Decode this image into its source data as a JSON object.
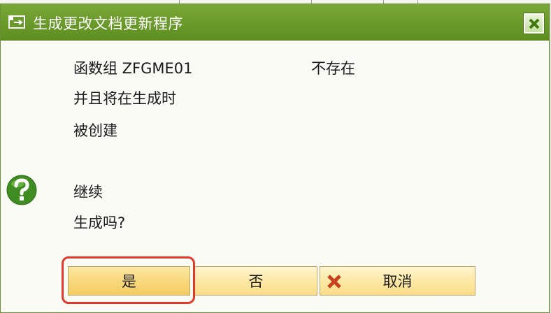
{
  "dialog": {
    "title": "生成更改文档更新程序",
    "close_icon": "close-icon"
  },
  "message": {
    "line1_left": "函数组 ZFGME01",
    "line1_right": "不存在",
    "line2": "并且将在生成时",
    "line3": "被创建",
    "line4": "继续",
    "line5": "生成吗?"
  },
  "icons": {
    "title": "dialog-icon",
    "question": "question-icon",
    "cancel": "x-icon"
  },
  "buttons": {
    "yes": "是",
    "no": "否",
    "cancel": "取消"
  },
  "colors": {
    "titlebar": "#6c9c2c",
    "button": "#fde9a6",
    "highlight": "#e23a2a"
  }
}
